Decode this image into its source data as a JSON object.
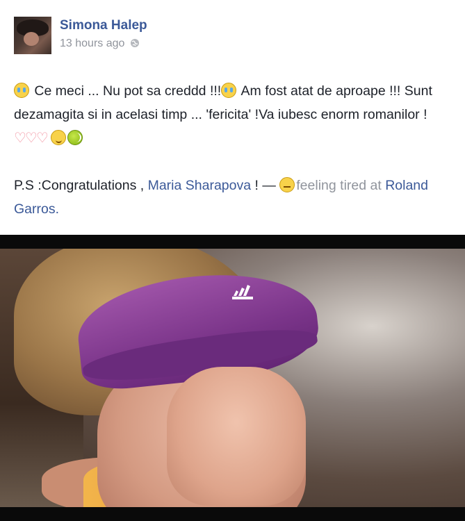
{
  "post": {
    "author": "Simona Halep",
    "timestamp": "13 hours ago",
    "privacy_icon": "globe-icon",
    "message_lines": {
      "part1": " Ce meci ... Nu pot sa creddd !!!",
      "part2": " Am fost atat de aproape !!! Sunt dezamagita si in acelasi timp ... 'fericita' !Va iubesc enorm romanilor !",
      "hearts": "♡♡♡"
    },
    "ps_prefix": "P.S :Congratulations , ",
    "tagged_person": "Maria Sharapova",
    "ps_suffix": " ! — ",
    "feeling_text": "feeling tired at",
    "location": "Roland Garros",
    "location_suffix": "."
  },
  "photo": {
    "icon": "photo-image",
    "visor_color": "#7a3489",
    "logo": "adidas-logo-icon"
  },
  "colors": {
    "link": "#3b5998",
    "muted": "#90949c",
    "text": "#1d2129"
  }
}
